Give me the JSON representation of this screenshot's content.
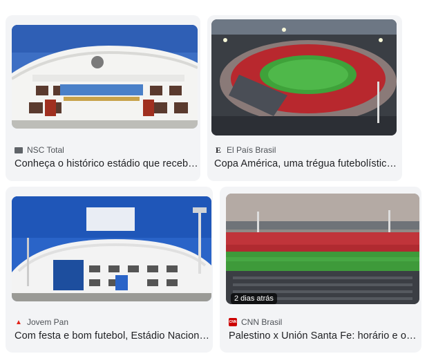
{
  "cards": [
    {
      "source": "NSC Total",
      "title": "Conheça o histórico estádio que receb…",
      "favicon": "nsc-total-icon"
    },
    {
      "source": "El País Brasil",
      "title": "Copa América, uma trégua futebolístic…",
      "favicon": "el-pais-icon"
    },
    {
      "source": "Jovem Pan",
      "title": "Com festa e bom futebol, Estádio Nacion…",
      "favicon": "jovem-pan-icon"
    },
    {
      "source": "CNN Brasil",
      "title": "Palestino x Unión Santa Fe: horário e o…",
      "favicon": "cnn-brasil-icon",
      "badge": "2 dias atrás"
    }
  ],
  "favicon_glyphs": {
    "el_pais": "E",
    "cnn": "CNN"
  },
  "colors": {
    "jovem_pan": "#e2231a",
    "cnn": "#cc0000",
    "text_muted": "#4d5156"
  }
}
